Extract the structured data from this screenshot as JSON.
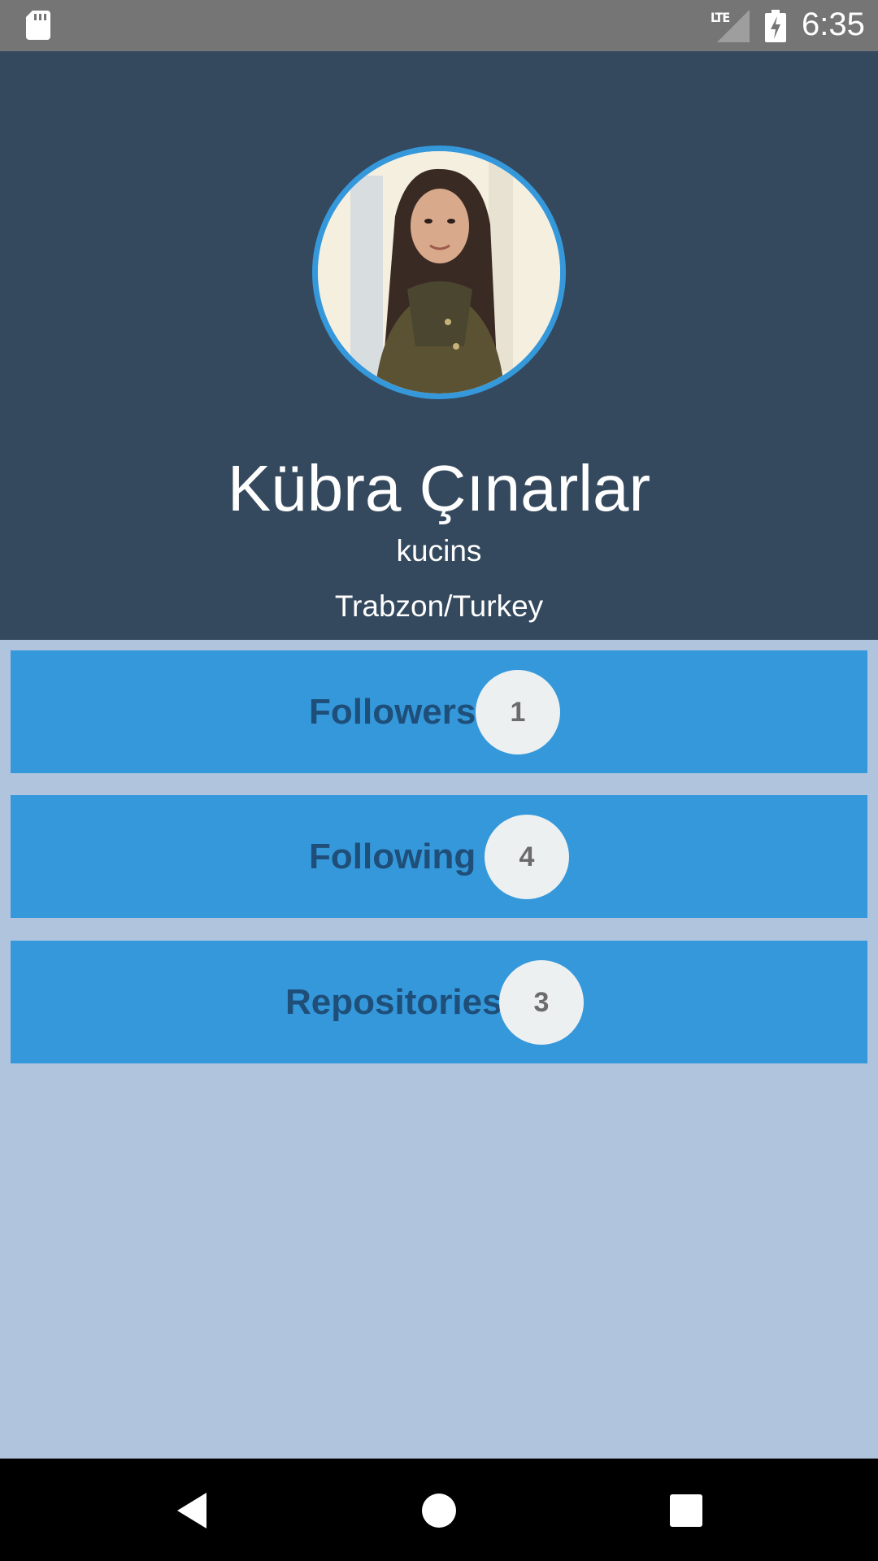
{
  "status_bar": {
    "network": "LTE",
    "time": "6:35",
    "icons": [
      "sd-card-icon",
      "lte-signal-icon",
      "battery-charging-icon"
    ]
  },
  "profile": {
    "full_name": "Kübra Çınarlar",
    "username": "kucins",
    "location": "Trabzon/Turkey"
  },
  "stats": [
    {
      "label": "Followers",
      "count": "1"
    },
    {
      "label": "Following",
      "count": "4"
    },
    {
      "label": "Repositories",
      "count": "3"
    }
  ],
  "colors": {
    "header_bg": "#34495e",
    "page_bg": "#b0c4de",
    "card_bg": "#3498db",
    "card_text": "#1f4e78",
    "badge_bg": "#ecf0f1",
    "avatar_border": "#3498db"
  },
  "nav": {
    "icons": [
      "back-icon",
      "home-icon",
      "recents-icon"
    ]
  }
}
